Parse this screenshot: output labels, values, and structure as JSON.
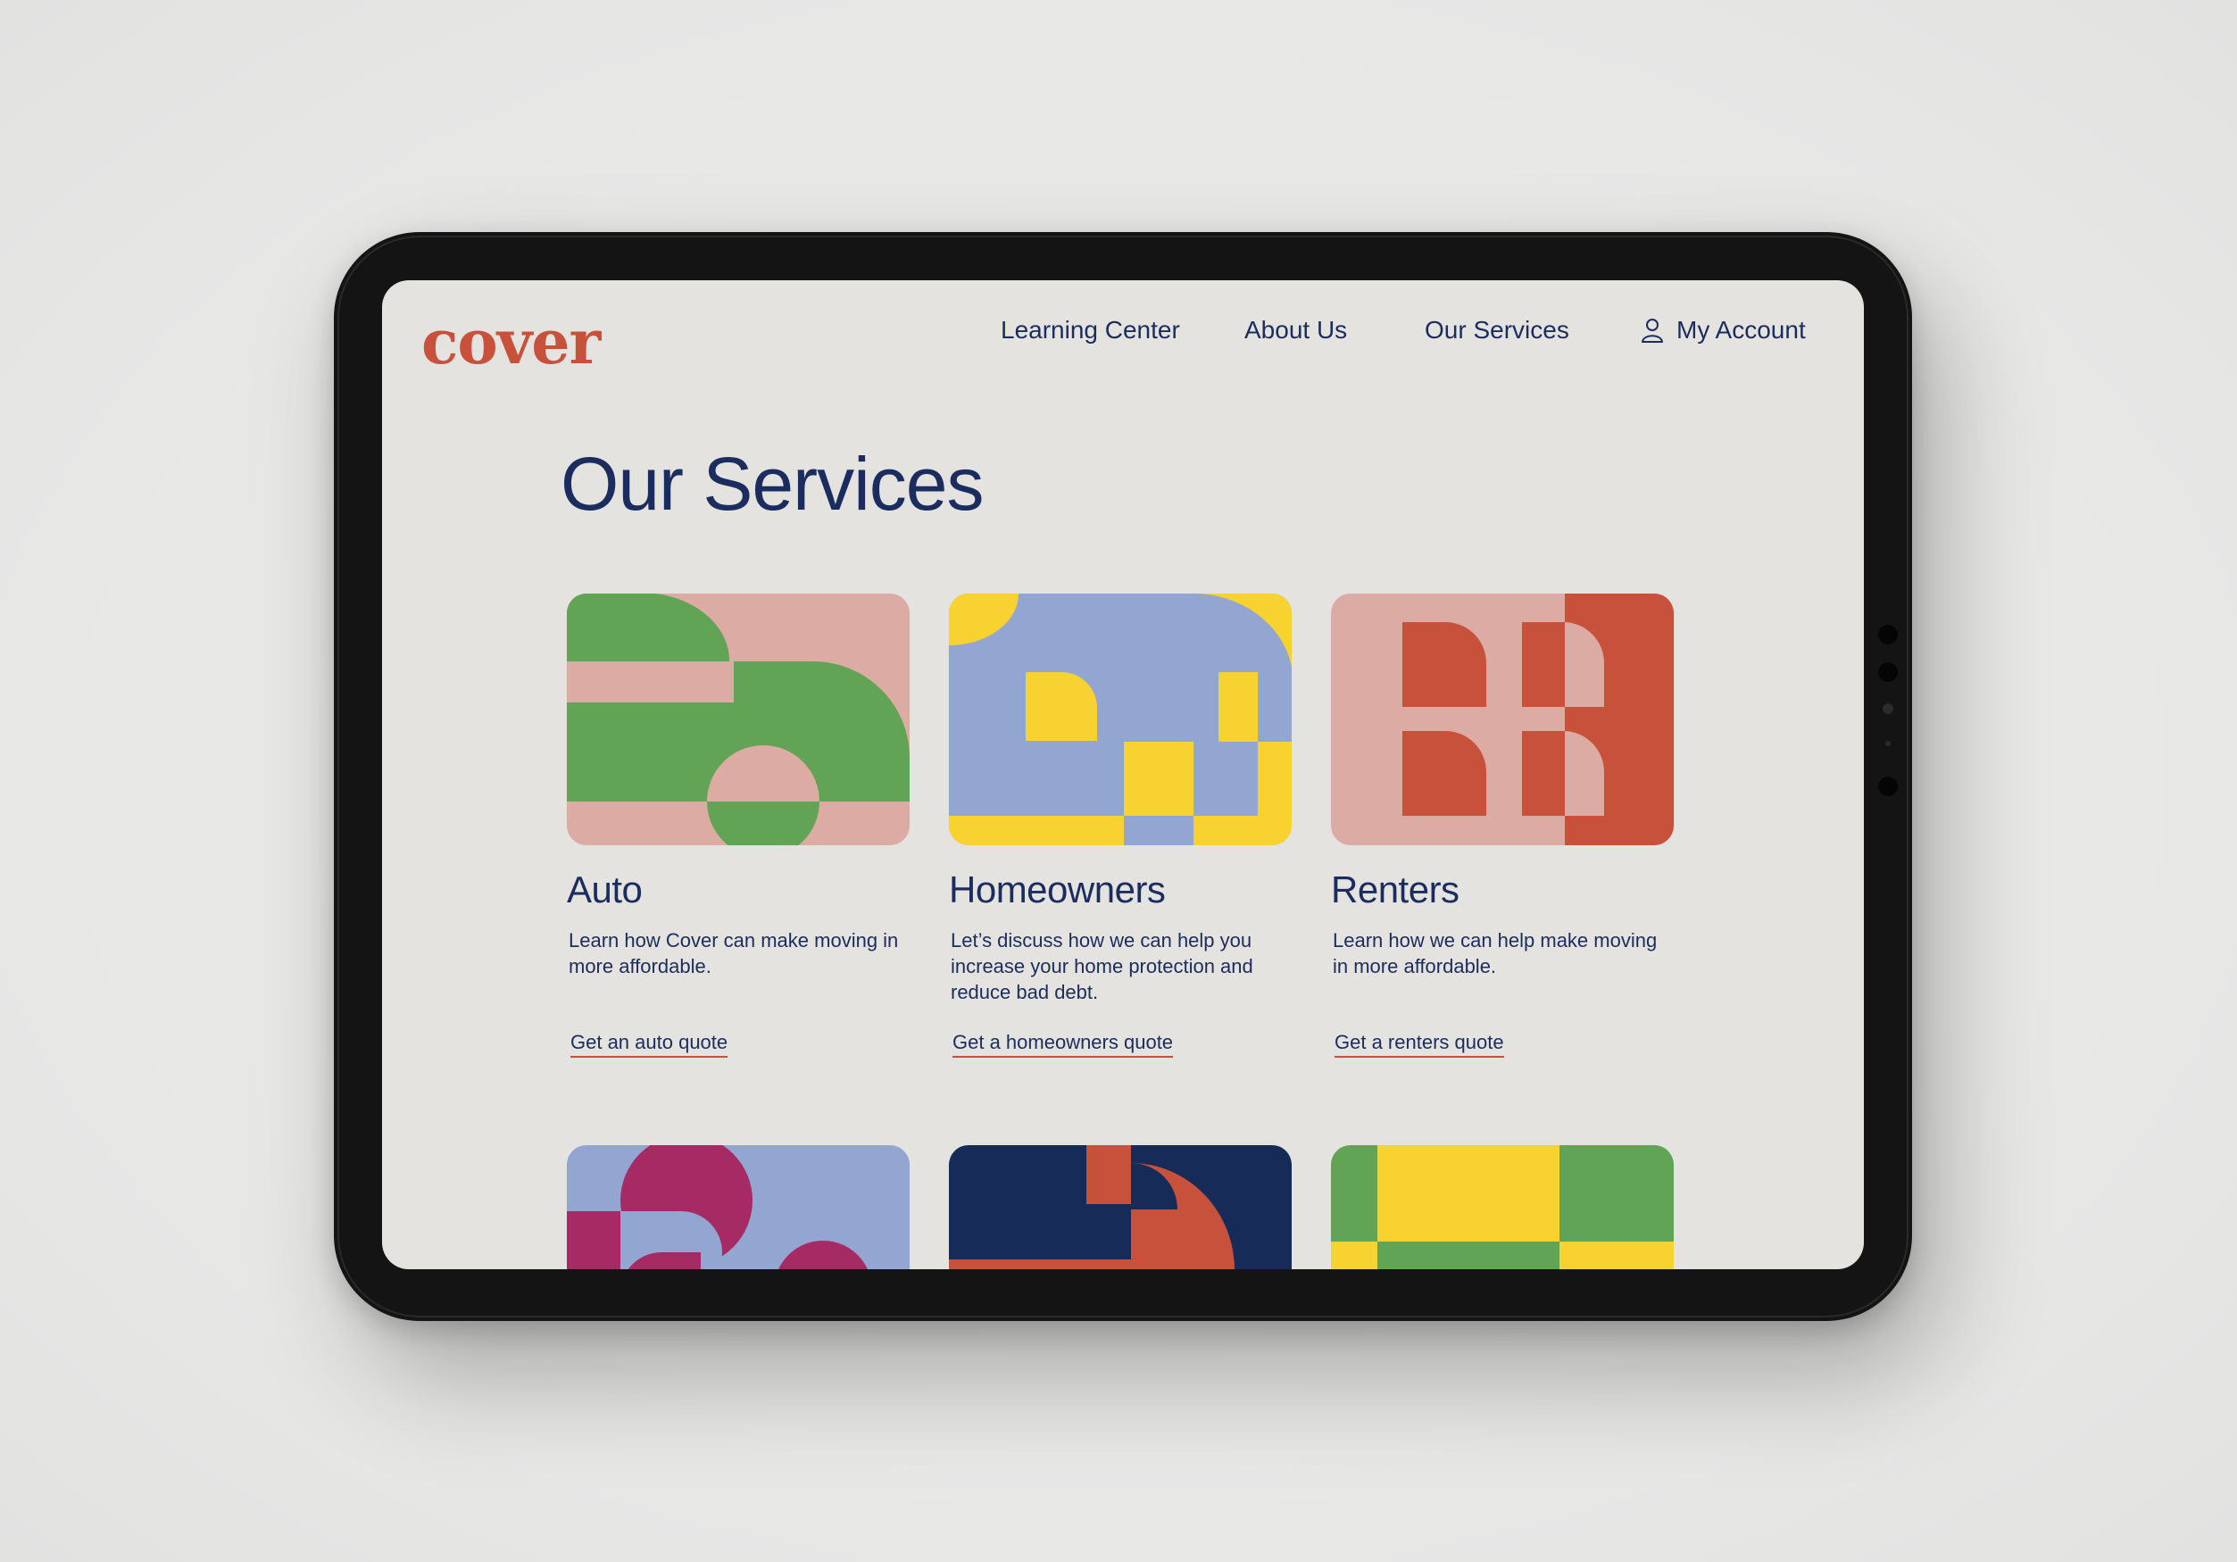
{
  "brand": {
    "logo": "cover",
    "color": "#c7513b",
    "ink": "#1b2d5e"
  },
  "nav": {
    "items": [
      "Learning Center",
      "About Us",
      "Our Services"
    ],
    "account_label": "My Account",
    "account_icon": "user-icon"
  },
  "page": {
    "title": "Our Services"
  },
  "services": [
    {
      "title": "Auto",
      "description": "Learn how Cover can make moving in more affordable.",
      "link": "Get an auto quote"
    },
    {
      "title": "Homeowners",
      "description": "Let’s discuss how we can help you increase your home protection and reduce bad debt.",
      "link": "Get a homeowners quote"
    },
    {
      "title": "Renters",
      "description": "Learn how we can help make moving in more affordable.",
      "link": "Get a renters quote"
    }
  ],
  "palette": {
    "green": "#61a456",
    "pink": "#dcaca4",
    "yellow": "#f7d230",
    "periwinkle": "#93a6d2",
    "red": "#c7513b",
    "magenta": "#a62a63",
    "navy": "#172b58"
  }
}
